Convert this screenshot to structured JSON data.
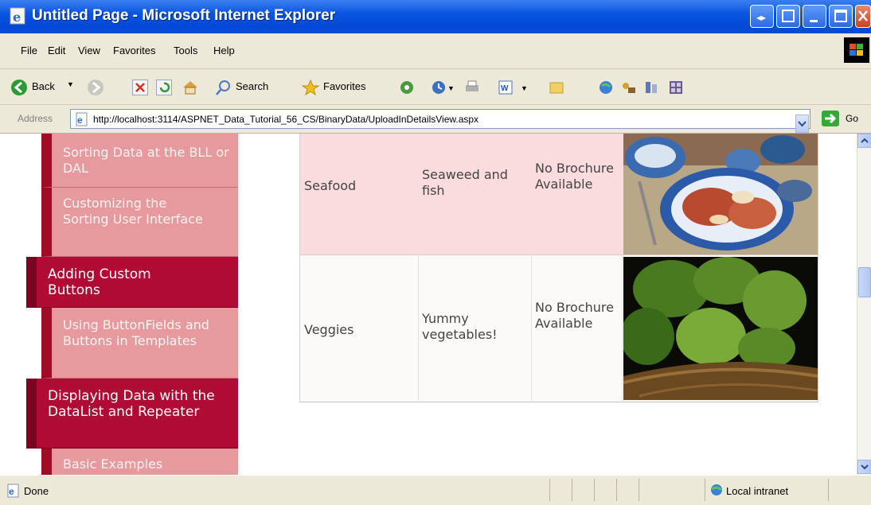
{
  "window": {
    "title": "Untitled Page - Microsoft Internet Explorer"
  },
  "menu": [
    "File",
    "Edit",
    "View",
    "Favorites",
    "Tools",
    "Help"
  ],
  "toolbar": {
    "back_label": "Back",
    "search_label": "Search",
    "favorites_label": "Favorites"
  },
  "address": {
    "label": "Address",
    "url": "http://localhost:3114/ASPNET_Data_Tutorial_56_CS/BinaryData/UploadInDetailsView.aspx",
    "go_label": "Go"
  },
  "sidebar": {
    "items": [
      {
        "label": "Sorting Data at the BLL or DAL",
        "type": "sub"
      },
      {
        "label": "Customizing the Sorting User Interface",
        "type": "sub"
      },
      {
        "label": "Adding Custom Buttons",
        "type": "section"
      },
      {
        "label": "Using ButtonFields and Buttons in Templates",
        "type": "sub"
      },
      {
        "label": "Displaying Data with the DataList and Repeater",
        "type": "section"
      },
      {
        "label": "Basic Examples",
        "type": "sub"
      }
    ]
  },
  "table": {
    "rows": [
      {
        "category": "Seafood",
        "description": "Seaweed and fish",
        "brochure": "No Brochure Available",
        "picture": "seafood-image"
      },
      {
        "category": "Veggies",
        "description": "Yummy vegetables!",
        "brochure": "No Brochure Available",
        "picture": "artichokes-image"
      }
    ]
  },
  "status": {
    "text": "Done",
    "zone": "Local intranet"
  },
  "colors": {
    "section_bg": "#b00b33",
    "sub_bg": "#e69a9e",
    "row1_bg": "#fadbde",
    "row2_bg": "#fcfaf9"
  }
}
